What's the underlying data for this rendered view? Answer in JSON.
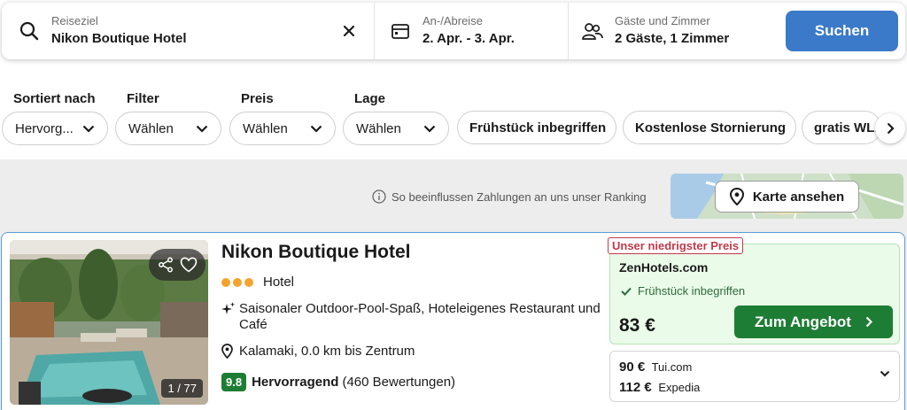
{
  "search": {
    "destination_label": "Reiseziel",
    "destination_value": "Nikon Boutique Hotel",
    "dates_label": "An-/Abreise",
    "dates_value": "2. Apr. - 3. Apr.",
    "guests_label": "Gäste und Zimmer",
    "guests_value": "2 Gäste, 1 Zimmer",
    "search_button": "Suchen"
  },
  "filters": {
    "sort": {
      "title": "Sortiert nach",
      "value": "Hervorg..."
    },
    "filter": {
      "title": "Filter",
      "value": "Wählen"
    },
    "price": {
      "title": "Preis",
      "value": "Wählen"
    },
    "location": {
      "title": "Lage",
      "value": "Wählen"
    },
    "chips": [
      "Frühstück inbegriffen",
      "Kostenlose Stornierung",
      "gratis WLAN"
    ]
  },
  "ranking_note": "So beeinflussen Zahlungen an uns unser Ranking",
  "map_button": "Karte ansehen",
  "hotel": {
    "name": "Nikon Boutique Hotel",
    "stars": 3,
    "type": "Hotel",
    "amenities": "Saisonaler Outdoor-Pool-Spaß, Hoteleigenes Restaurant und Café",
    "location": "Kalamaki, 0.0 km bis Zentrum",
    "rating_score": "9.8",
    "rating_word": "Hervorragend",
    "rating_count": "(460 Bewertungen)",
    "photo_counter": "1 / 77"
  },
  "best_offer": {
    "tag": "Unser niedrigster Preis",
    "provider": "ZenHotels.com",
    "perk": "Frühstück inbegriffen",
    "price": "83 €",
    "button": "Zum Angebot"
  },
  "other_offers": [
    {
      "price": "90 €",
      "provider": "Tui.com"
    },
    {
      "price": "112 €",
      "provider": "Expedia"
    }
  ],
  "colors": {
    "search_button": "#3b7ac9",
    "deal_button": "#1e7d34",
    "rating_badge": "#1e7d34",
    "best_tag": "#c23a4a",
    "star_dots": "#f4a32c"
  }
}
